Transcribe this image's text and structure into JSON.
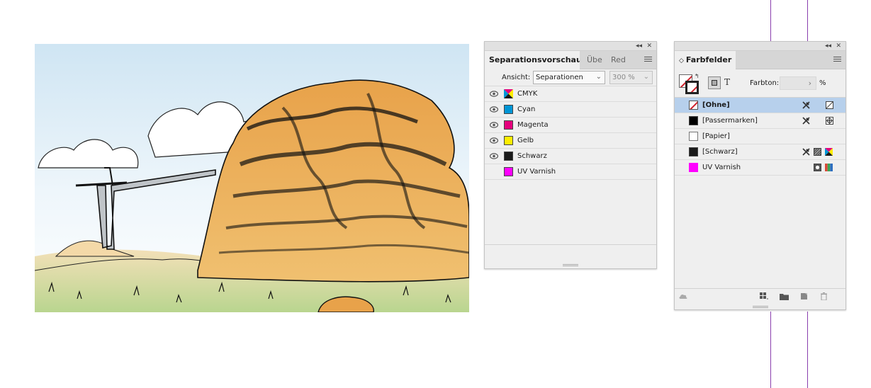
{
  "colors": {
    "guide": "#8a3fae",
    "panel_bg": "#efefef",
    "selected_row": "#b7d0ec",
    "cyan": "#0096d6",
    "magenta": "#e4007c",
    "yellow": "#ffed00",
    "black": "#1a1a1a",
    "uv_varnish": "#ff00ff"
  },
  "separations_panel": {
    "tabs": [
      {
        "label": "Separationsvorschau",
        "active": true
      },
      {
        "label": "Übe",
        "active": false
      },
      {
        "label": "Red",
        "active": false
      }
    ],
    "view_label": "Ansicht:",
    "view_value": "Separationen",
    "zoom_value": "300 %",
    "rows": [
      {
        "label": "CMYK",
        "icon": "cmyk-icon",
        "visible": true
      },
      {
        "label": "Cyan",
        "color": "#0096d6",
        "visible": true
      },
      {
        "label": "Magenta",
        "color": "#e4007c",
        "visible": true
      },
      {
        "label": "Gelb",
        "color": "#ffed00",
        "visible": true
      },
      {
        "label": "Schwarz",
        "color": "#1a1a1a",
        "visible": true
      },
      {
        "label": "UV Varnish",
        "color": "#ff00ff",
        "visible": false
      }
    ]
  },
  "swatches_panel": {
    "title": "Farbfelder",
    "tint_label": "Farbton:",
    "tint_value": "",
    "tint_unit": "%",
    "rows": [
      {
        "label": "[Ohne]",
        "swatch": "none",
        "selected": true
      },
      {
        "label": "[Passermarken]",
        "swatch": "#000000",
        "selected": false
      },
      {
        "label": "[Papier]",
        "swatch": "#ffffff",
        "selected": false
      },
      {
        "label": "[Schwarz]",
        "swatch": "#1a1a1a",
        "selected": false
      },
      {
        "label": "UV Varnish",
        "swatch": "#ff00ff",
        "selected": false
      }
    ]
  }
}
